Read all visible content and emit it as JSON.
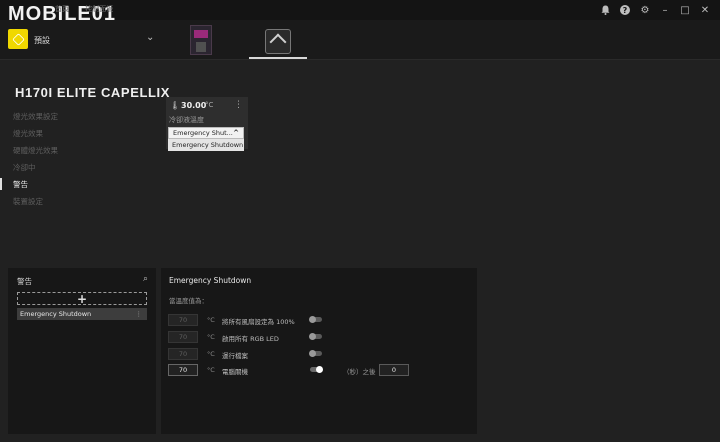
{
  "topbar": {
    "logo": "MOBILE01",
    "nav": [
      "首頁",
      "控制面板"
    ],
    "icons": [
      "bell-icon",
      "help-icon",
      "gear-icon",
      "minimize-icon",
      "maximize-icon",
      "close-icon"
    ]
  },
  "profile": {
    "label": "預設",
    "accent": "#f0d800"
  },
  "device": {
    "title": "H170I ELITE CAPELLIX"
  },
  "sidenav": {
    "items": [
      {
        "label": "燈光效果設定"
      },
      {
        "label": "燈光效果"
      },
      {
        "label": "硬體燈光效果"
      },
      {
        "label": "冷卻中"
      },
      {
        "label": "警告"
      },
      {
        "label": "裝置設定"
      }
    ],
    "active": "警告"
  },
  "sensor": {
    "temp": "30.00",
    "unit": "°C",
    "name": "冷卻液溫度",
    "selected": "Emergency Shut...",
    "option": "Emergency Shutdown"
  },
  "alerts_panel": {
    "title": "警告",
    "add": "+",
    "items": [
      {
        "label": "Emergency Shutdown"
      }
    ]
  },
  "detail": {
    "title": "Emergency Shutdown",
    "subtitle": "當溫度值為：",
    "rows": [
      {
        "value": "70",
        "unit": "°C",
        "label": "將所有風扇設定為 100%",
        "enabled": false
      },
      {
        "value": "70",
        "unit": "°C",
        "label": "啟用所有 RGB LED",
        "enabled": false
      },
      {
        "value": "70",
        "unit": "°C",
        "label": "運行檔案",
        "enabled": false
      },
      {
        "value": "70",
        "unit": "°C",
        "label": "電腦關機",
        "enabled": true
      }
    ],
    "after_label": "（秒）之後",
    "delay_value": "0"
  }
}
